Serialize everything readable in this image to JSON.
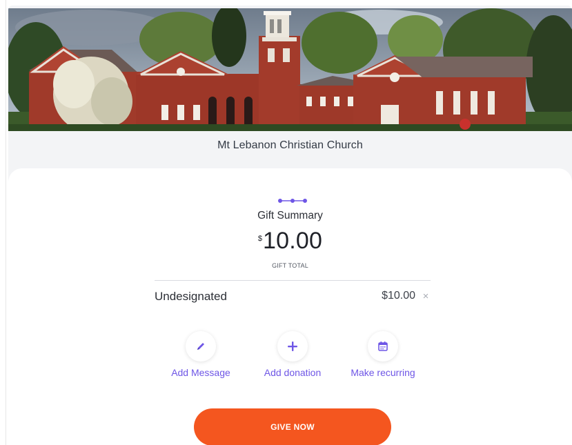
{
  "organization": {
    "name": "Mt Lebanon Christian Church",
    "hero_image": "church-building-photo"
  },
  "summary": {
    "title": "Gift Summary",
    "currency_symbol": "$",
    "amount": "10.00",
    "total_label": "GIFT TOTAL",
    "step_indicator": "progress-dots-icon"
  },
  "funds": [
    {
      "name": "Undesignated",
      "amount": "$10.00",
      "remove_symbol": "×"
    }
  ],
  "actions": [
    {
      "label": "Add Message",
      "icon": "pencil-icon"
    },
    {
      "label": "Add donation",
      "icon": "plus-icon"
    },
    {
      "label": "Make recurring",
      "icon": "calendar-icon"
    }
  ],
  "give_button": {
    "label": "GIVE NOW"
  },
  "colors": {
    "accent": "#6e56e6",
    "cta": "#f4561f",
    "background": "#f3f4f6",
    "card": "#ffffff",
    "text": "#2c2f36"
  }
}
